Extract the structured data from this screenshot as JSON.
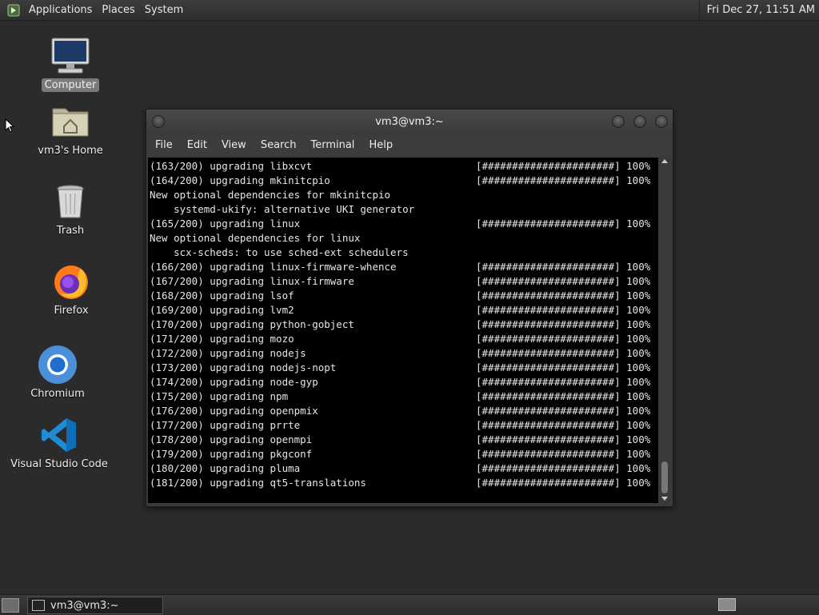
{
  "top_panel": {
    "menus": [
      "Applications",
      "Places",
      "System"
    ],
    "clock": "Fri Dec 27, 11:51 AM"
  },
  "desktop_icons": [
    {
      "label": "Computer",
      "icon": "computer-icon"
    },
    {
      "label": "vm3's Home",
      "icon": "home-folder-icon"
    },
    {
      "label": "Trash",
      "icon": "trash-icon"
    },
    {
      "label": "Firefox",
      "icon": "firefox-icon"
    },
    {
      "label": "Chromium",
      "icon": "chromium-icon"
    },
    {
      "label": "Visual Studio Code",
      "icon": "vscode-icon"
    }
  ],
  "terminal": {
    "title": "vm3@vm3:~",
    "menus": [
      "File",
      "Edit",
      "View",
      "Search",
      "Terminal",
      "Help"
    ],
    "lines": [
      {
        "text": "(163/200) upgrading libxcvt",
        "progress": "[######################] 100%"
      },
      {
        "text": "(164/200) upgrading mkinitcpio",
        "progress": "[######################] 100%"
      },
      {
        "text": "New optional dependencies for mkinitcpio",
        "progress": ""
      },
      {
        "text": "    systemd-ukify: alternative UKI generator",
        "progress": ""
      },
      {
        "text": "(165/200) upgrading linux",
        "progress": "[######################] 100%"
      },
      {
        "text": "New optional dependencies for linux",
        "progress": ""
      },
      {
        "text": "    scx-scheds: to use sched-ext schedulers",
        "progress": ""
      },
      {
        "text": "(166/200) upgrading linux-firmware-whence",
        "progress": "[######################] 100%"
      },
      {
        "text": "(167/200) upgrading linux-firmware",
        "progress": "[######################] 100%"
      },
      {
        "text": "(168/200) upgrading lsof",
        "progress": "[######################] 100%"
      },
      {
        "text": "(169/200) upgrading lvm2",
        "progress": "[######################] 100%"
      },
      {
        "text": "(170/200) upgrading python-gobject",
        "progress": "[######################] 100%"
      },
      {
        "text": "(171/200) upgrading mozo",
        "progress": "[######################] 100%"
      },
      {
        "text": "(172/200) upgrading nodejs",
        "progress": "[######################] 100%"
      },
      {
        "text": "(173/200) upgrading nodejs-nopt",
        "progress": "[######################] 100%"
      },
      {
        "text": "(174/200) upgrading node-gyp",
        "progress": "[######################] 100%"
      },
      {
        "text": "(175/200) upgrading npm",
        "progress": "[######################] 100%"
      },
      {
        "text": "(176/200) upgrading openpmix",
        "progress": "[######################] 100%"
      },
      {
        "text": "(177/200) upgrading prrte",
        "progress": "[######################] 100%"
      },
      {
        "text": "(178/200) upgrading openmpi",
        "progress": "[######################] 100%"
      },
      {
        "text": "(179/200) upgrading pkgconf",
        "progress": "[######################] 100%"
      },
      {
        "text": "(180/200) upgrading pluma",
        "progress": "[######################] 100%"
      },
      {
        "text": "(181/200) upgrading qt5-translations",
        "progress": "[######################] 100%"
      }
    ]
  },
  "bottom_panel": {
    "task_label": "vm3@vm3:~"
  }
}
